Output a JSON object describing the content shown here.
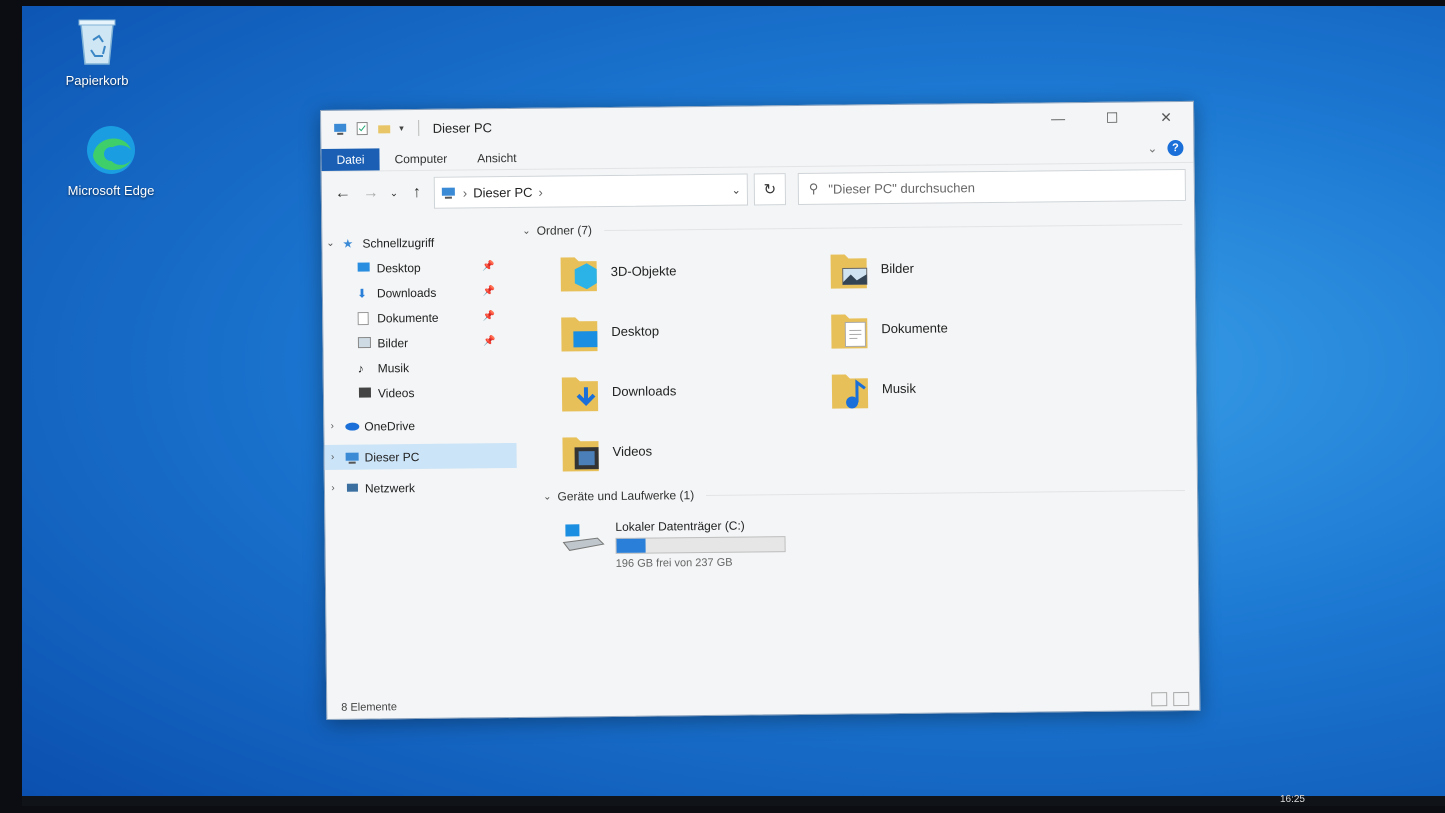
{
  "desktop": {
    "icons": [
      {
        "label": "Papierkorb"
      },
      {
        "label": "Microsoft Edge"
      }
    ]
  },
  "window": {
    "title": "Dieser PC",
    "ribbon_tabs": [
      "Datei",
      "Computer",
      "Ansicht"
    ],
    "address": "Dieser PC",
    "search_placeholder": "\"Dieser PC\" durchsuchen",
    "nav": {
      "quick_access": "Schnellzugriff",
      "quick_items": [
        "Desktop",
        "Downloads",
        "Dokumente",
        "Bilder",
        "Musik",
        "Videos"
      ],
      "onedrive": "OneDrive",
      "this_pc": "Dieser PC",
      "network": "Netzwerk"
    },
    "folders_header": "Ordner (7)",
    "folders": [
      "3D-Objekte",
      "Bilder",
      "Desktop",
      "Dokumente",
      "Downloads",
      "Musik",
      "Videos"
    ],
    "devices_header": "Geräte und Laufwerke (1)",
    "drive": {
      "name": "Lokaler Datenträger (C:)",
      "free_text": "196 GB frei von 237 GB",
      "used_fraction": 0.17
    },
    "status": "8 Elemente"
  },
  "taskbar": {
    "clock": "16:25"
  }
}
